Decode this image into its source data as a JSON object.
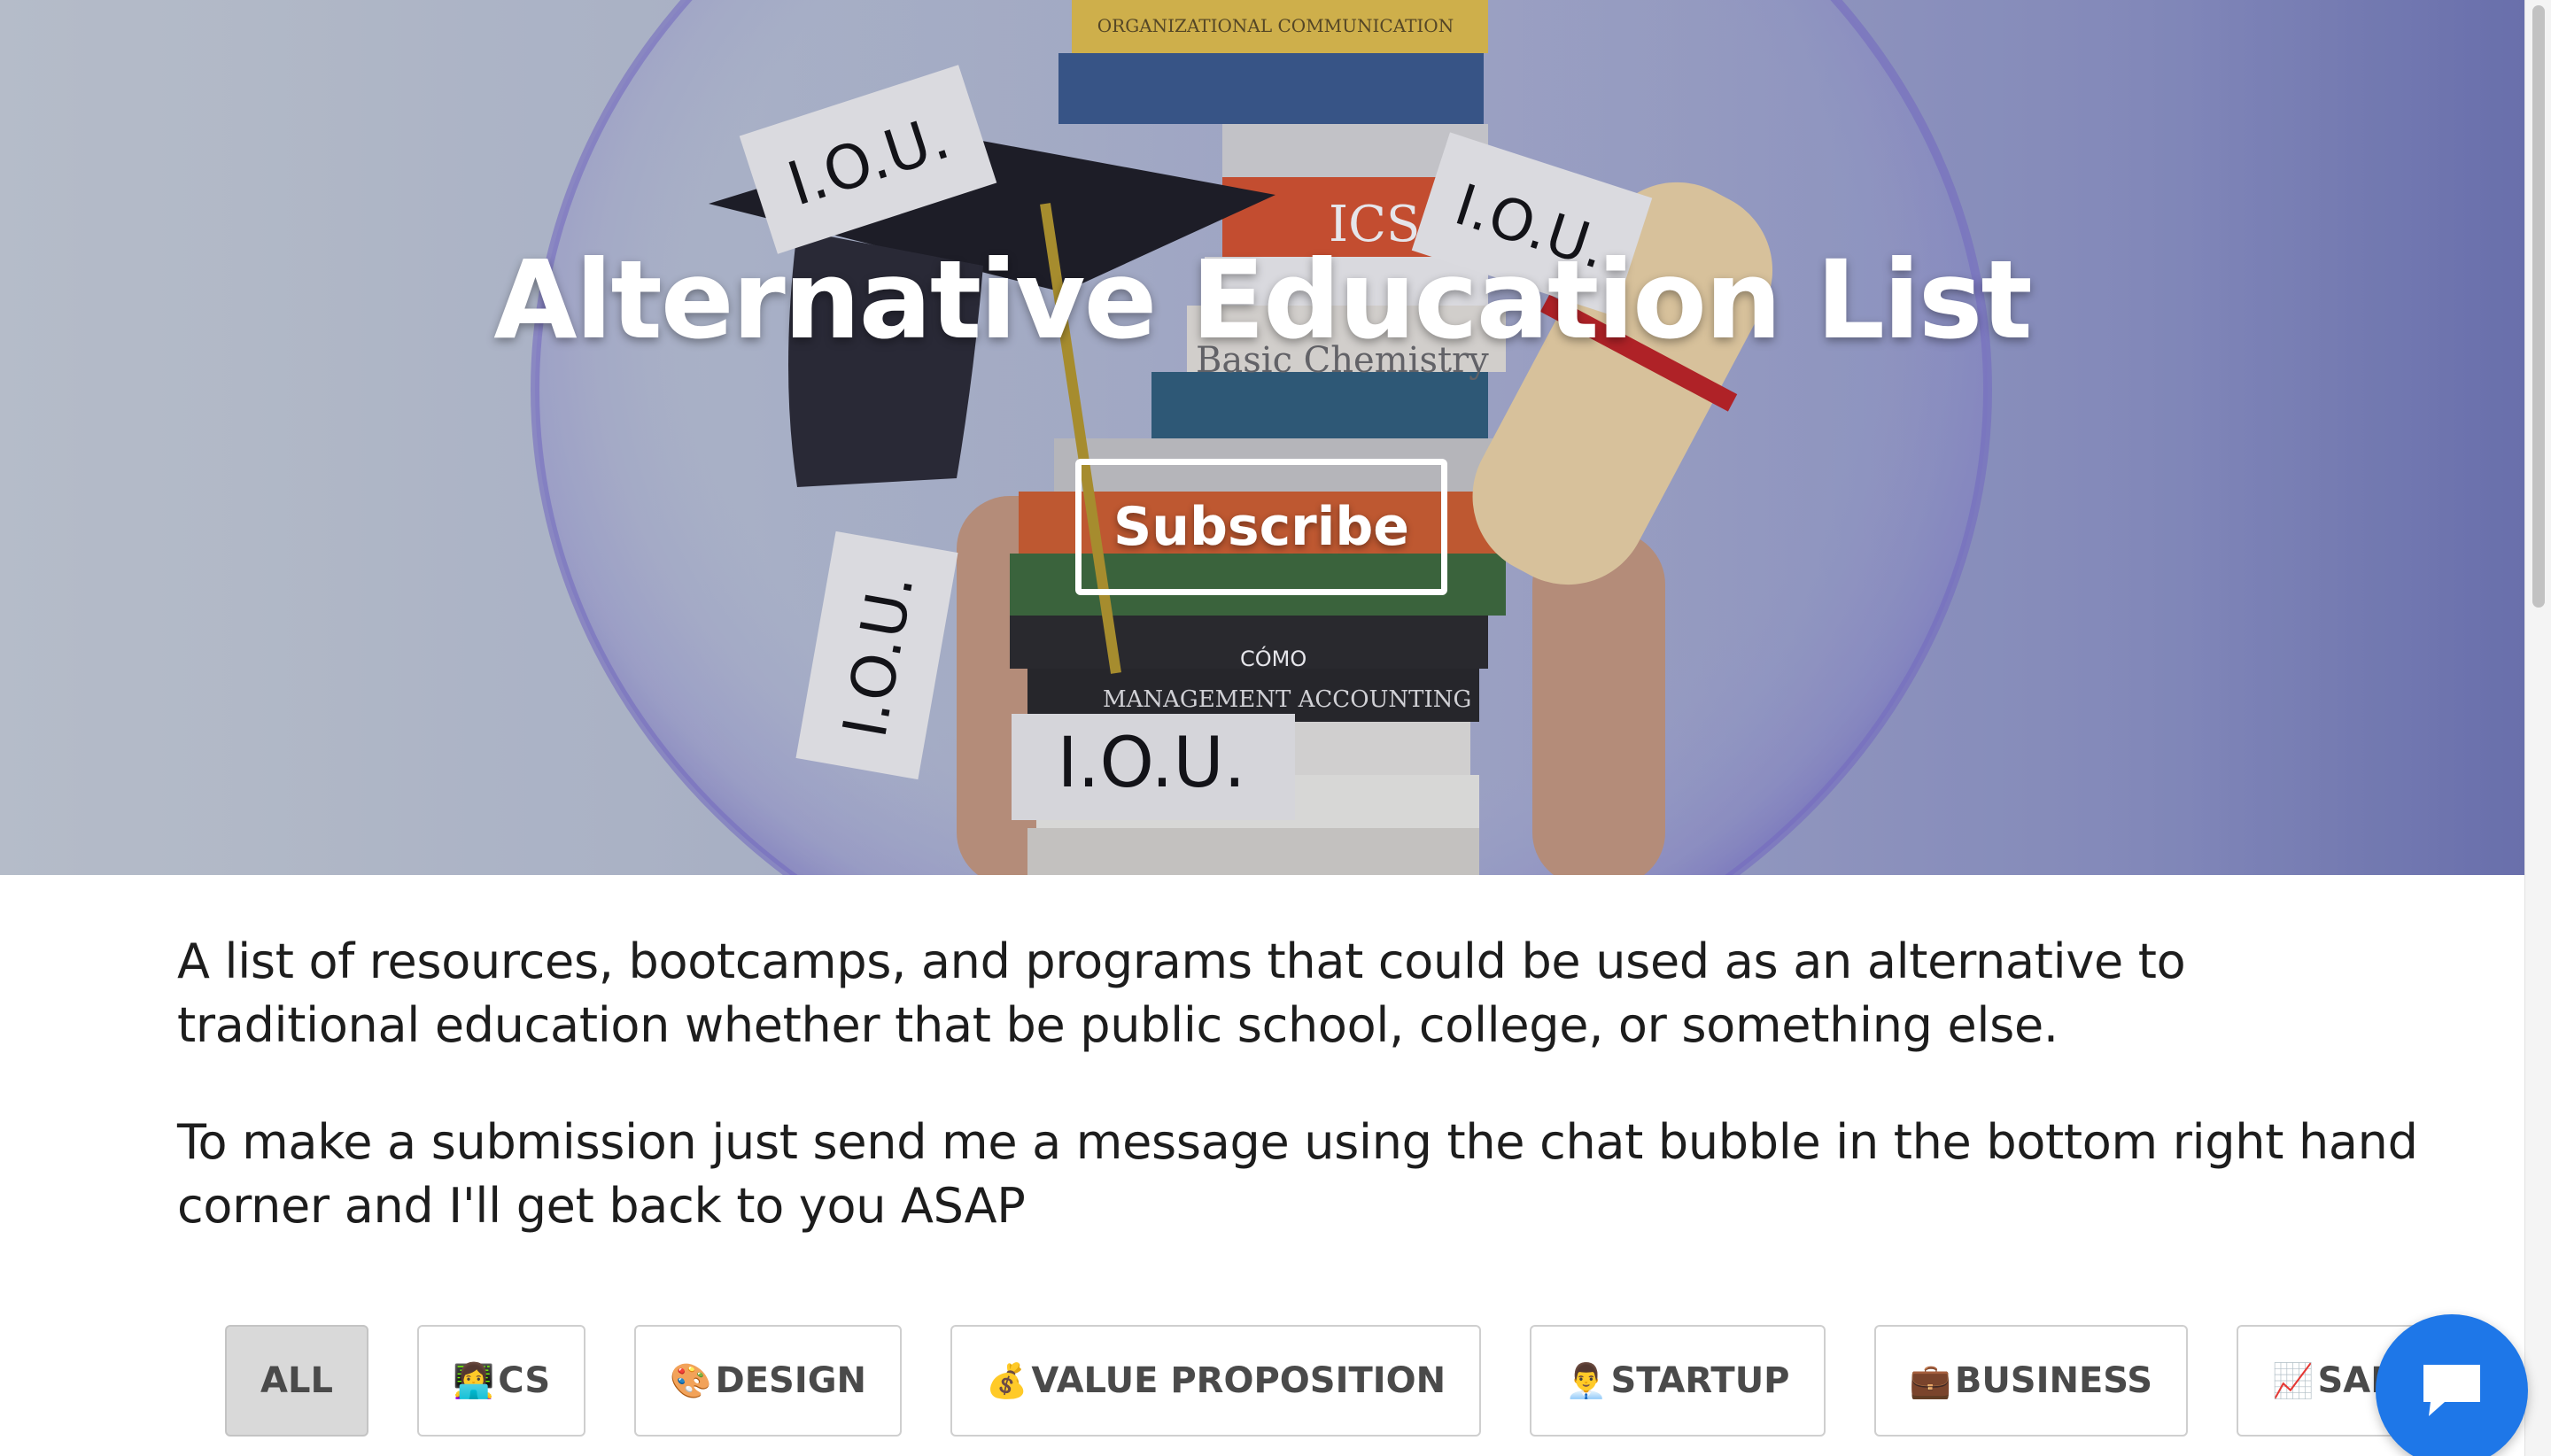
{
  "hero": {
    "title": "Alternative Education List",
    "subscribe_label": "Subscribe",
    "image_text": {
      "iou_1": "I.O.U.",
      "iou_2": "I.O.U.",
      "iou_3": "I.O.U.",
      "iou_4": "I.O.U.",
      "book_top": "ORGANIZATIONAL COMMUNICATION",
      "book_economics": "ICS",
      "book_chemistry": "Basic Chemistry",
      "book_accounting": "MANAGEMENT ACCOUNTING",
      "book_como": "CÓMO"
    }
  },
  "intro": {
    "paragraph_1": "A list of resources, bootcamps, and programs that could be used as an alternative to traditional education whether that be public school, college, or something else.",
    "paragraph_2": "To make a submission just send me a message using the chat bubble in the bottom right hand corner and I'll get back to you ASAP"
  },
  "filters": [
    {
      "emoji": "",
      "label": "ALL",
      "active": true
    },
    {
      "emoji": "👩‍💻",
      "label": "CS",
      "active": false
    },
    {
      "emoji": "🎨",
      "label": "DESIGN",
      "active": false
    },
    {
      "emoji": "💰",
      "label": "VALUE PROPOSITION",
      "active": false
    },
    {
      "emoji": "👨‍💼",
      "label": "STARTUP",
      "active": false
    },
    {
      "emoji": "💼",
      "label": "BUSINESS",
      "active": false
    },
    {
      "emoji": "📈",
      "label": "SALES",
      "active": false
    }
  ],
  "chat": {
    "icon": "chat-bubble-icon",
    "color": "#1e77e8"
  },
  "colors": {
    "hero_overlay": "#8f96c8",
    "active_filter": "#d9d9d9"
  }
}
